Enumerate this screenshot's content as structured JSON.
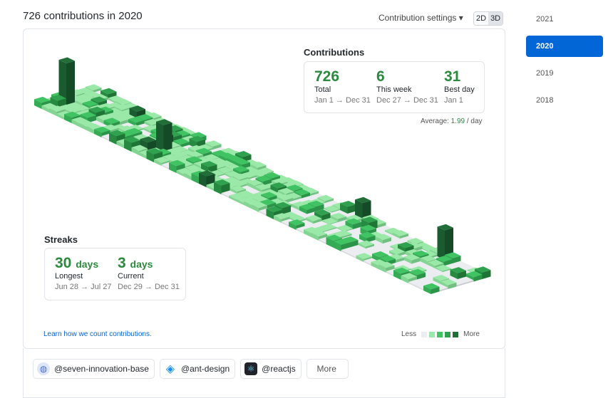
{
  "header": {
    "title": "726 contributions in 2020",
    "settings": "Contribution settings ▾",
    "toggle_2d": "2D",
    "toggle_3d": "3D"
  },
  "contributions": {
    "heading": "Contributions",
    "total": {
      "value": "726",
      "label": "Total",
      "range": "Jan 1 → Dec 31"
    },
    "week": {
      "value": "6",
      "label": "This week",
      "range": "Dec 27 → Dec 31"
    },
    "best": {
      "value": "31",
      "label": "Best day",
      "range": "Jan 1"
    },
    "average_label": "Average:",
    "average_value": "1.99",
    "average_unit": " / day"
  },
  "streaks": {
    "heading": "Streaks",
    "longest": {
      "value": "30",
      "unit": "days",
      "label": "Longest",
      "range": "Jun 28 → Jul 27"
    },
    "current": {
      "value": "3",
      "unit": "days",
      "label": "Current",
      "range": "Dec 29 → Dec 31"
    }
  },
  "footer": {
    "learn_link": "Learn how we count contributions.",
    "less": "Less",
    "more": "More",
    "legend_colors": [
      "#ebedf0",
      "#9be9a8",
      "#40c463",
      "#30a14e",
      "#216e39"
    ]
  },
  "orgs": [
    {
      "name": "@seven-innovation-base",
      "icon": "planet-icon"
    },
    {
      "name": "@ant-design",
      "icon": "ant-design-logo-icon"
    },
    {
      "name": "@reactjs",
      "icon": "react-atom-icon"
    }
  ],
  "orgs_more": "More",
  "years": [
    {
      "label": "2021",
      "selected": false
    },
    {
      "label": "2020",
      "selected": true
    },
    {
      "label": "2019",
      "selected": false
    },
    {
      "label": "2018",
      "selected": false
    }
  ]
}
